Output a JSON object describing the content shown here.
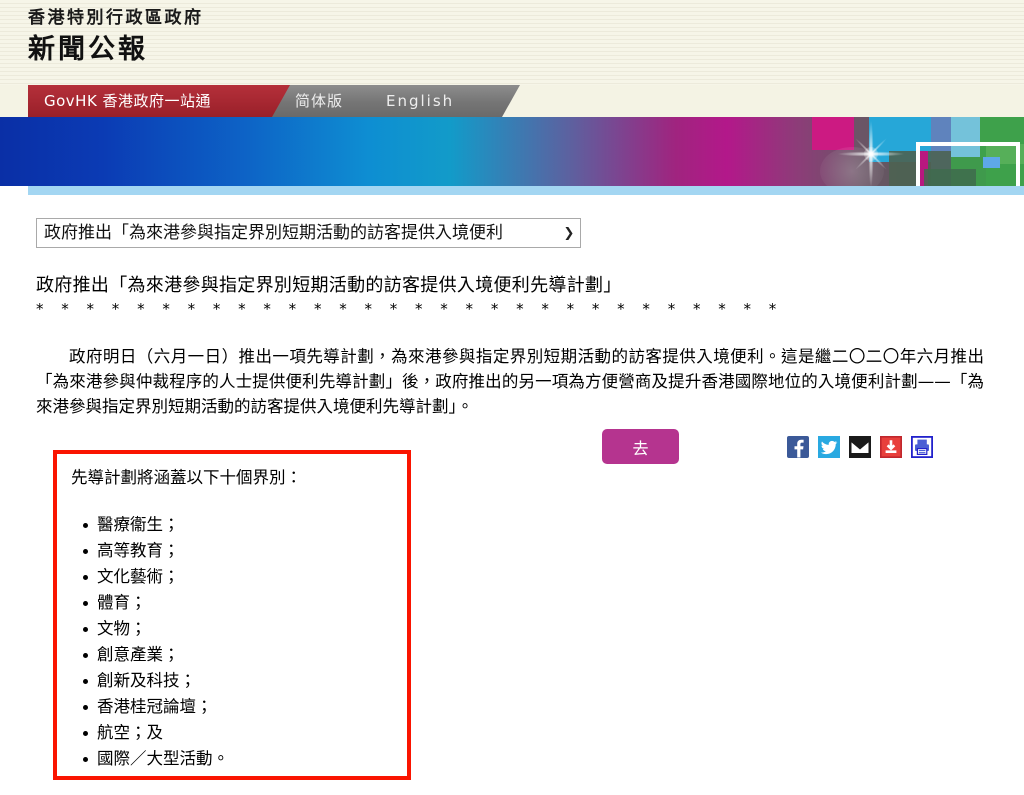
{
  "masthead": {
    "government_name": "香港特別行政區政府",
    "publication_name": "新聞公報"
  },
  "nav": {
    "brand_label": "GovHK 香港政府一站通",
    "links": [
      {
        "label": "简体版"
      },
      {
        "label": "English"
      }
    ]
  },
  "toolbar": {
    "select_value": "政府推出「為來港參與指定界別短期活動的訪客提供入境便利",
    "select_arrow": "chevron-down-icon",
    "go_label": "去",
    "share_icons": [
      {
        "name": "facebook-icon",
        "color": "#3b5998"
      },
      {
        "name": "twitter-icon",
        "color": "#29a9e1"
      },
      {
        "name": "email-icon",
        "color": "#1a1a1a"
      },
      {
        "name": "download-icon",
        "color": "#c0272d"
      },
      {
        "name": "print-icon",
        "color": "#2222cc"
      }
    ]
  },
  "article": {
    "headline": "政府推出「為來港參與指定界別短期活動的訪客提供入境便利先導計劃」",
    "separator": "*  *  *  *  *  *  *  *  *  *  *  *  *  *  *  *  *  *  *  *  *  *  *  *  *  *  *  *  *  *",
    "paragraph": "政府明日（六月一日）推出一項先導計劃，為來港參與指定界別短期活動的訪客提供入境便利。這是繼二〇二〇年六月推出「為來港參與仲裁程序的人士提供便利先導計劃」後，政府推出的另一項為方便營商及提升香港國際地位的入境便利計劃——「為來港參與指定界別短期活動的訪客提供入境便利先導計劃」。"
  },
  "sector_box": {
    "border_color": "#fa1400",
    "lead_text": "先導計劃將涵蓋以下十個界別：",
    "items": [
      {
        "label": "醫療衞生；"
      },
      {
        "label": "高等教育；"
      },
      {
        "label": "文化藝術；"
      },
      {
        "label": "體育；"
      },
      {
        "label": "文物；"
      },
      {
        "label": "創意產業；"
      },
      {
        "label": "創新及科技；"
      },
      {
        "label": "香港桂冠論壇；"
      },
      {
        "label": "航空；及"
      },
      {
        "label": "國際／大型活動。"
      }
    ]
  }
}
